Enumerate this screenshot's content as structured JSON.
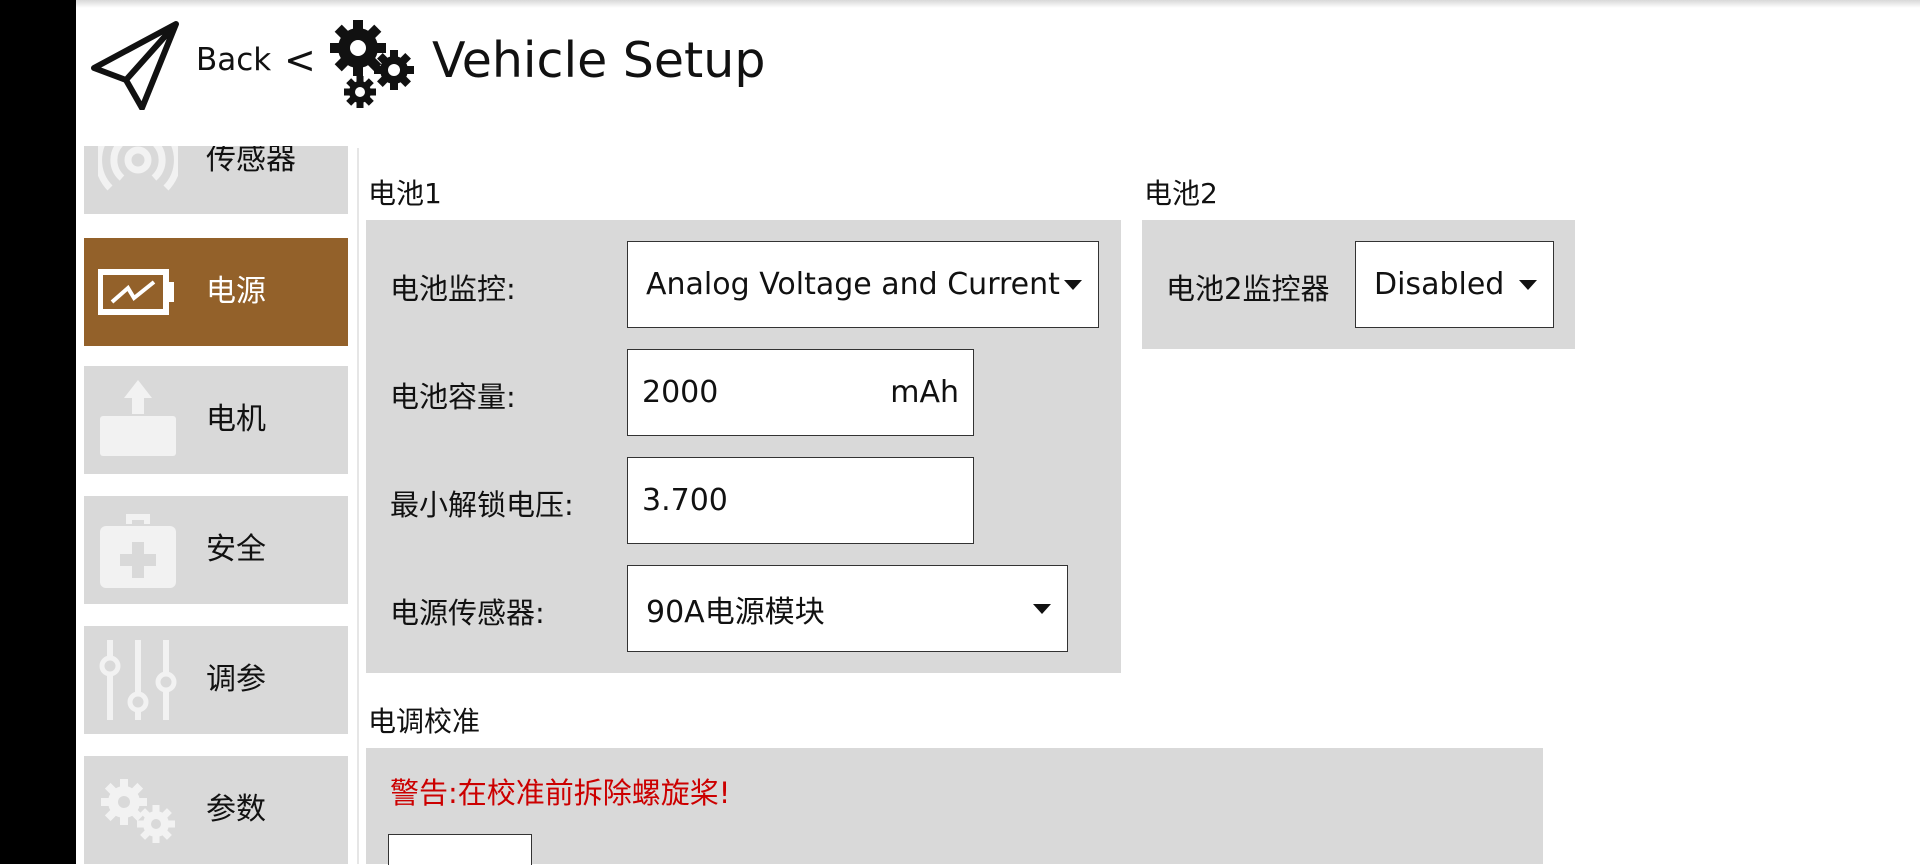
{
  "header": {
    "back_label": "Back",
    "separator": "<",
    "title": "Vehicle Setup"
  },
  "sidebar": {
    "items": [
      {
        "label": "传感器",
        "icon": "sensor-icon",
        "active": false
      },
      {
        "label": "电源",
        "icon": "battery-icon",
        "active": true
      },
      {
        "label": "电机",
        "icon": "motor-icon",
        "active": false
      },
      {
        "label": "安全",
        "icon": "safety-icon",
        "active": false
      },
      {
        "label": "调参",
        "icon": "sliders-icon",
        "active": false
      },
      {
        "label": "参数",
        "icon": "gears-icon",
        "active": false
      }
    ]
  },
  "battery1": {
    "title": "电池1",
    "monitor_label": "电池监控:",
    "monitor_value": "Analog Voltage and Current",
    "capacity_label": "电池容量:",
    "capacity_value": "2000",
    "capacity_unit": "mAh",
    "min_arm_label": "最小解锁电压:",
    "min_arm_value": "3.700",
    "sensor_label": "电源传感器:",
    "sensor_value": "90A电源模块"
  },
  "battery2": {
    "title": "电池2",
    "monitor_label": "电池2监控器",
    "monitor_value": "Disabled"
  },
  "esc": {
    "title": "电调校准",
    "warning": "警告:在校准前拆除螺旋桨!"
  },
  "colors": {
    "active_nav": "#93612a",
    "panel_bg": "#d9d9d9",
    "warning": "#cc0000"
  }
}
